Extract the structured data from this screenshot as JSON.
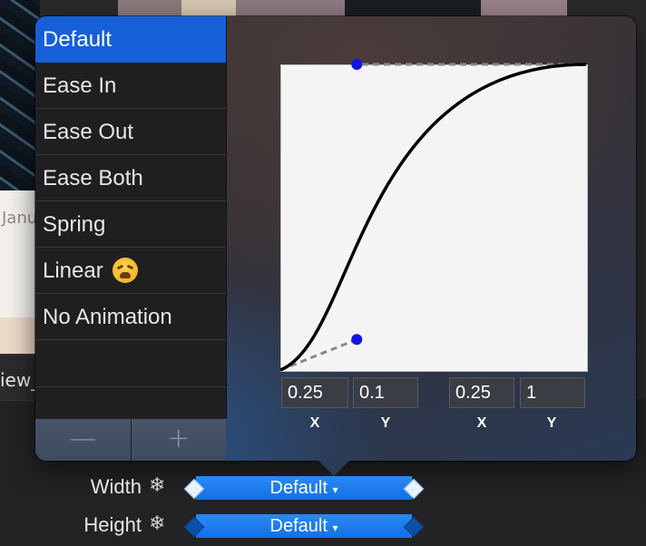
{
  "background": {
    "card_date_fragment": "Janu",
    "label_fragment": "iew_"
  },
  "presets": [
    {
      "label": "Default",
      "selected": true
    },
    {
      "label": "Ease In",
      "selected": false
    },
    {
      "label": "Ease Out",
      "selected": false
    },
    {
      "label": "Ease Both",
      "selected": false
    },
    {
      "label": "Spring",
      "selected": false
    },
    {
      "label": "Linear",
      "selected": false,
      "icon": "weary-face-emoji"
    },
    {
      "label": "No Animation",
      "selected": false
    }
  ],
  "list_controls": {
    "remove_label": "—",
    "add_label": "+"
  },
  "curve": {
    "p1": {
      "x": "0.25",
      "y": "0.1"
    },
    "p2": {
      "x": "0.25",
      "y": "1"
    },
    "labels": {
      "x": "X",
      "y": "Y"
    },
    "colors": {
      "curve": "#000000",
      "handle": "#1414e6",
      "handle_line": "#888888",
      "background": "#f4f4f4"
    }
  },
  "inspector": {
    "width": {
      "label": "Width",
      "value": "Default"
    },
    "height": {
      "label": "Height",
      "value": "Default"
    }
  },
  "colors": {
    "selection": "#1560d8",
    "pill": "#1b7cf0"
  }
}
